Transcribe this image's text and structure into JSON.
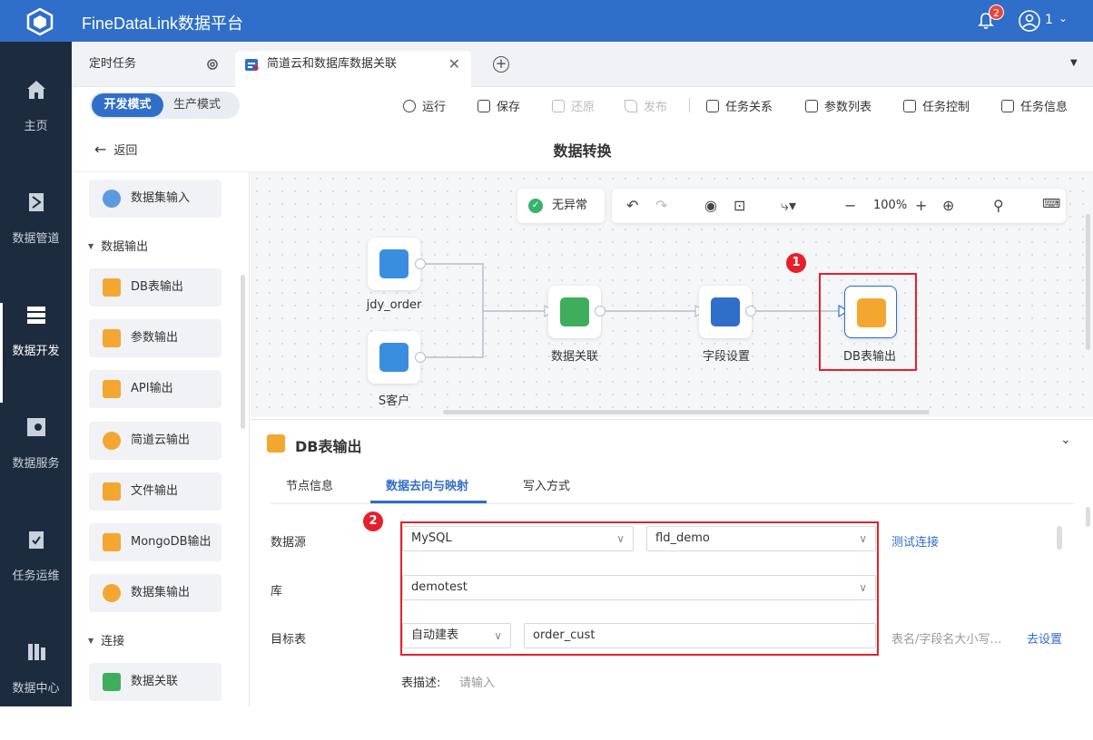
{
  "app": {
    "title": "FineDataLink数据平台",
    "notifications": "2",
    "user": "1"
  },
  "nav": [
    {
      "label": "主页",
      "icon": "home-icon"
    },
    {
      "label": "数据管道",
      "icon": "pipeline-icon"
    },
    {
      "label": "数据开发",
      "icon": "dev-icon"
    },
    {
      "label": "数据服务",
      "icon": "service-icon"
    },
    {
      "label": "任务运维",
      "icon": "ops-icon"
    },
    {
      "label": "数据中心",
      "icon": "datacenter-icon"
    }
  ],
  "tabs": {
    "scheduled": "定时任务",
    "active": "简道云和数据库数据关联"
  },
  "mode": {
    "dev": "开发模式",
    "prod": "生产模式"
  },
  "toolbar": {
    "run": "运行",
    "save": "保存",
    "restore": "还原",
    "publish": "发布",
    "relations": "任务关系",
    "params": "参数列表",
    "control": "任务控制",
    "info": "任务信息"
  },
  "header": {
    "back": "返回",
    "title": "数据转换"
  },
  "components": {
    "dataset_input": "数据集输入",
    "group_output": "数据输出",
    "db_output": "DB表输出",
    "param_output": "参数输出",
    "api_output": "API输出",
    "jdy_output": "简道云输出",
    "file_output": "文件输出",
    "mongo_output": "MongoDB输出",
    "dataset_output": "数据集输出",
    "group_join": "连接",
    "data_join": "数据关联"
  },
  "canvas": {
    "status": "无异常",
    "zoom": "100%",
    "nodes": {
      "jdy_order": "jdy_order",
      "s_customer": "S客户",
      "join": "数据关联",
      "fields": "字段设置",
      "db_output": "DB表输出"
    },
    "markers": [
      "1",
      "2"
    ]
  },
  "props": {
    "title": "DB表输出",
    "tabs": [
      "节点信息",
      "数据去向与映射",
      "写入方式"
    ],
    "datasource_label": "数据源",
    "datasource_type": "MySQL",
    "connection": "fld_demo",
    "test_connection": "测试连接",
    "db_label": "库",
    "db_value": "demotest",
    "target_label": "目标表",
    "target_mode": "自动建表",
    "target_table": "order_cust",
    "case_hint": "表名/字段名大小写…",
    "go_settings": "去设置",
    "desc_label": "表描述:",
    "desc_placeholder": "请输入"
  },
  "colors": {
    "primary": "#2f6ec9",
    "sidebar": "#1d2b3f",
    "highlight": "#e5202a"
  }
}
